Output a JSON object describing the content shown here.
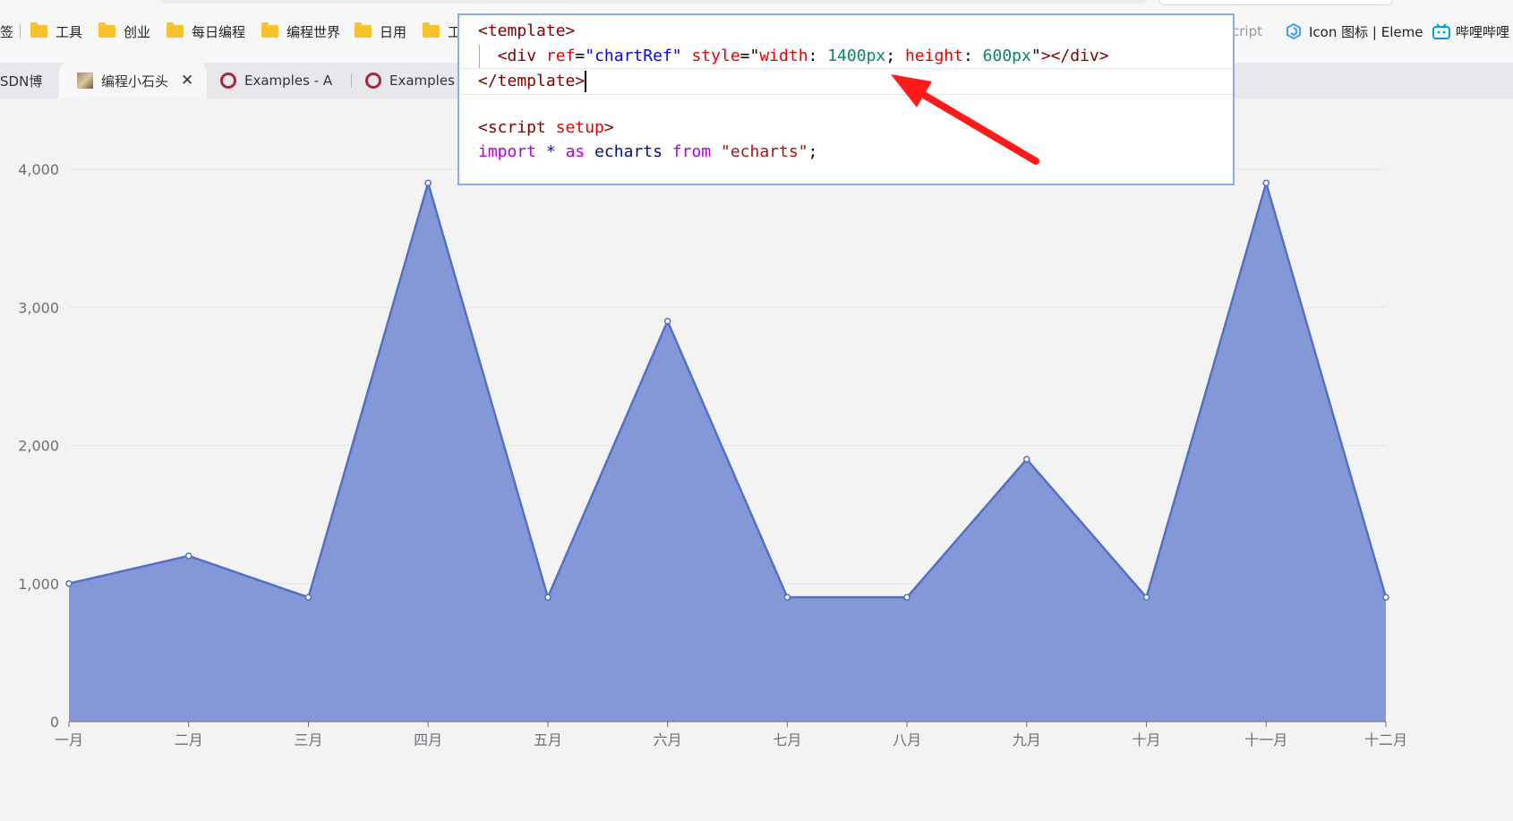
{
  "bookmarks": [
    {
      "label": "签",
      "type": "text"
    },
    {
      "label": "工具",
      "type": "folder"
    },
    {
      "label": "创业",
      "type": "folder"
    },
    {
      "label": "每日编程",
      "type": "folder"
    },
    {
      "label": "编程世界",
      "type": "folder"
    },
    {
      "label": "日用",
      "type": "folder"
    },
    {
      "label": "工",
      "type": "folder"
    },
    {
      "label": "cript",
      "type": "text"
    },
    {
      "label": "Icon 图标 | Eleme",
      "type": "link"
    },
    {
      "label": "哔哩哔哩",
      "type": "link"
    }
  ],
  "tabs": [
    {
      "label": "SDN博"
    },
    {
      "label": "编程小石头",
      "active": true,
      "close": "✕"
    },
    {
      "label": "Examples - A"
    },
    {
      "label": "Examples"
    }
  ],
  "code": {
    "line1": "<template>",
    "line2_open": "<div",
    "line2_ref_attr": "ref",
    "line2_ref_val": "\"chartRef\"",
    "line2_style_attr": "style",
    "line2_q1": "\"",
    "line2_width_prop": "width",
    "line2_width_val": "1400px",
    "line2_height_prop": "height",
    "line2_height_val": "600px",
    "line2_q2": "\"",
    "line2_end": "></div>",
    "line3": "</template>",
    "line5_tag": "<script",
    "line5_attr": "setup",
    "line5_end": ">",
    "line6_import": "import",
    "line6_star": "*",
    "line6_as": "as",
    "line6_id": "echarts",
    "line6_from": "from",
    "line6_str": "\"echarts\"",
    "line6_semi": ";"
  },
  "colors": {
    "area": "#8497d6",
    "line": "#5470c6",
    "arrow": "#ff1a1a"
  },
  "chart_data": {
    "type": "area",
    "categories": [
      "一月",
      "二月",
      "三月",
      "四月",
      "五月",
      "六月",
      "七月",
      "八月",
      "九月",
      "十月",
      "十一月",
      "十二月"
    ],
    "values": [
      1000,
      1200,
      900,
      3900,
      900,
      2900,
      900,
      900,
      1900,
      900,
      3900,
      900
    ],
    "yticks": [
      "0",
      "1,000",
      "2,000",
      "3,000",
      "4,000"
    ],
    "ylim": [
      0,
      4000
    ],
    "grid": true
  }
}
